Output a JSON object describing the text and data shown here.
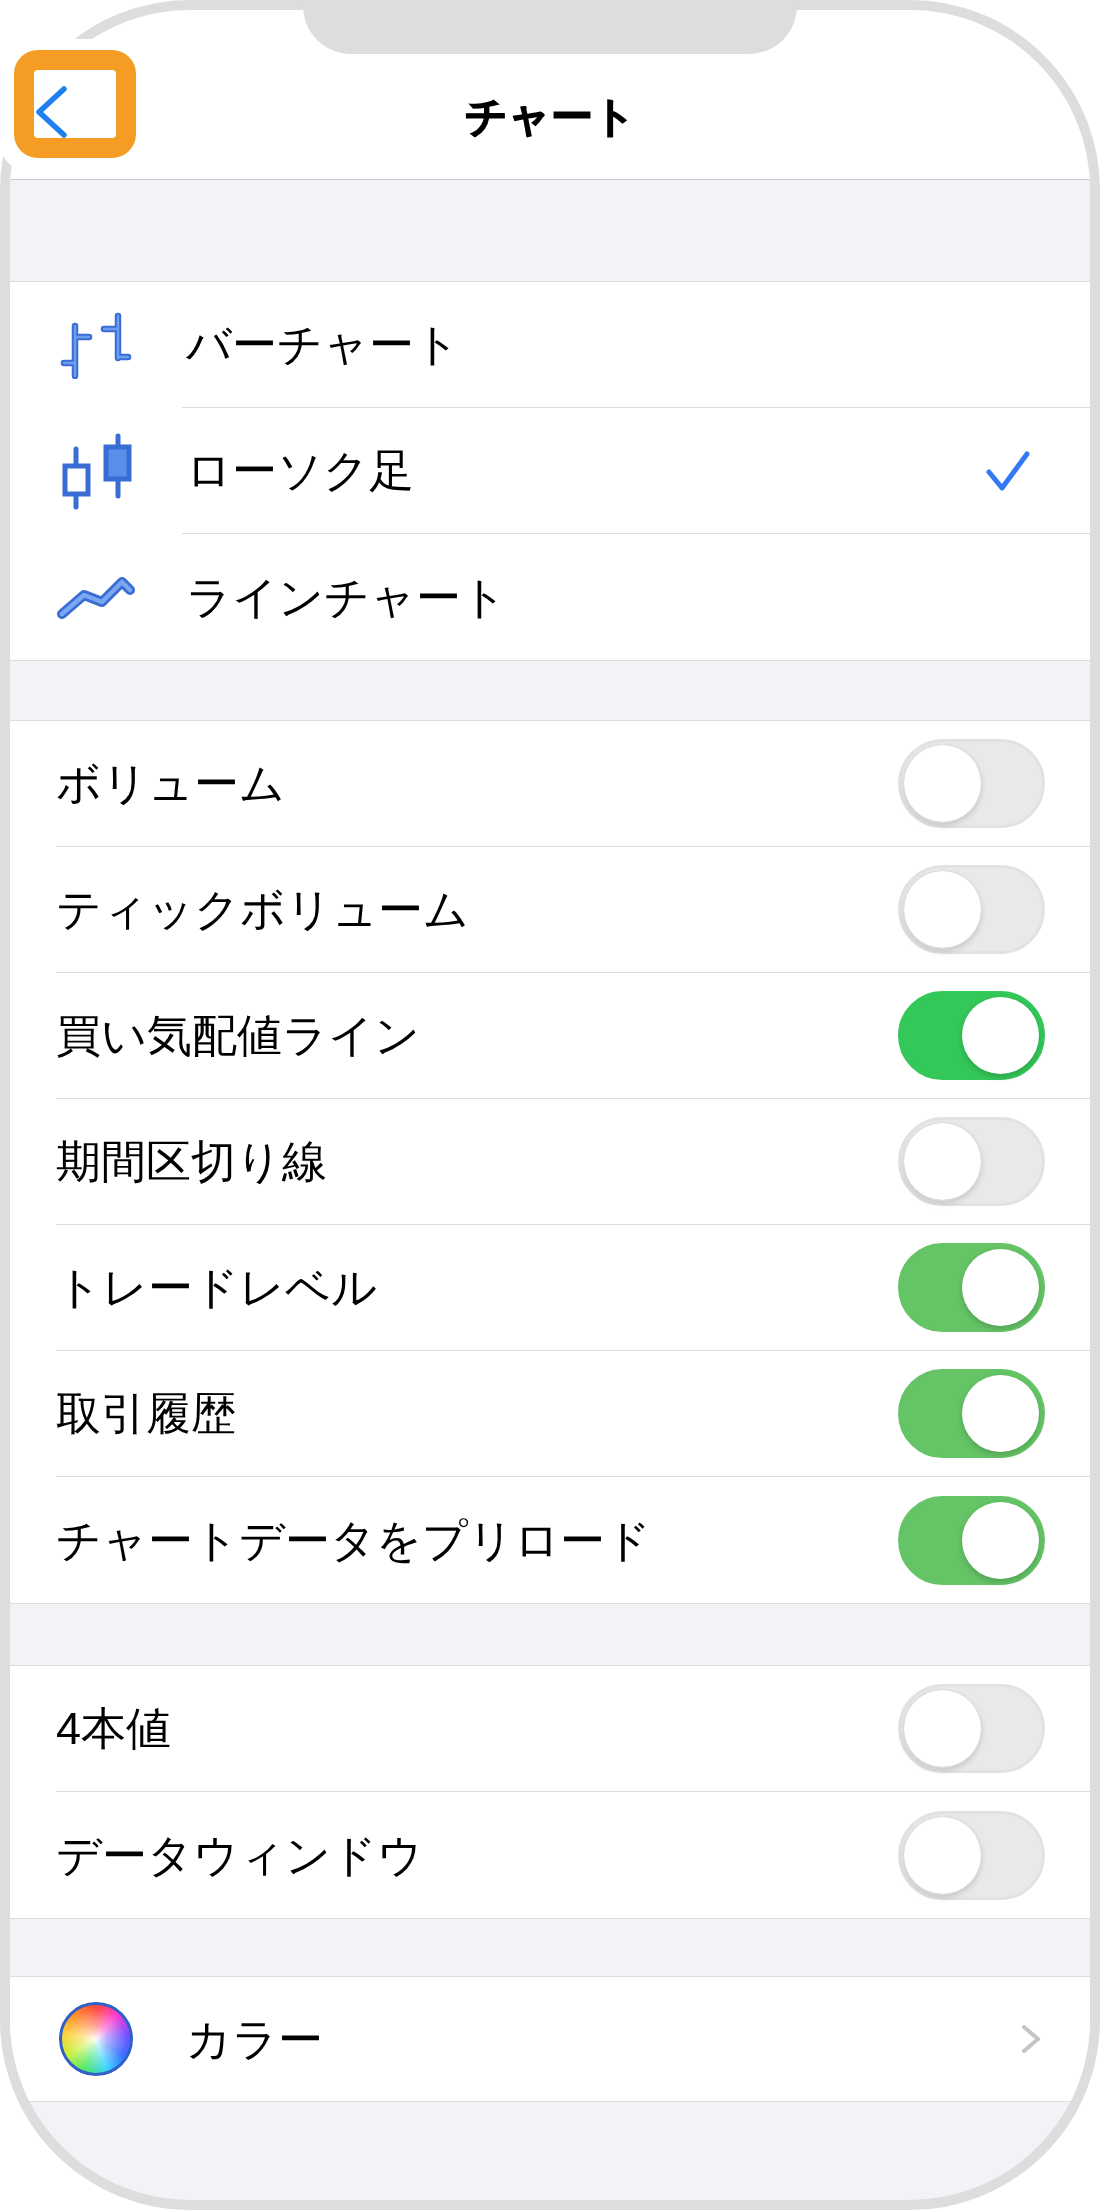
{
  "nav": {
    "title": "チャート",
    "back_button": {
      "highlighted": true
    }
  },
  "chart_types": [
    {
      "label": "バーチャート",
      "kind": "bar",
      "selected": false
    },
    {
      "label": "ローソク足",
      "kind": "candlestick",
      "selected": true
    },
    {
      "label": "ラインチャート",
      "kind": "line",
      "selected": false
    }
  ],
  "display_options": [
    {
      "label": "ボリューム",
      "on": false
    },
    {
      "label": "ティックボリューム",
      "on": false
    },
    {
      "label": "買い気配値ライン",
      "on": true,
      "color": "#34c759"
    },
    {
      "label": "期間区切り線",
      "on": false
    },
    {
      "label": "トレードレベル",
      "on": true,
      "color": "#65c466"
    },
    {
      "label": "取引履歴",
      "on": true,
      "color": "#65c466"
    },
    {
      "label": "チャートデータをプリロード",
      "on": true,
      "color": "#65c466"
    }
  ],
  "extra_options": [
    {
      "label": "4本値",
      "on": false
    },
    {
      "label": "データウィンドウ",
      "on": false
    }
  ],
  "color_row": {
    "label": "カラー"
  }
}
